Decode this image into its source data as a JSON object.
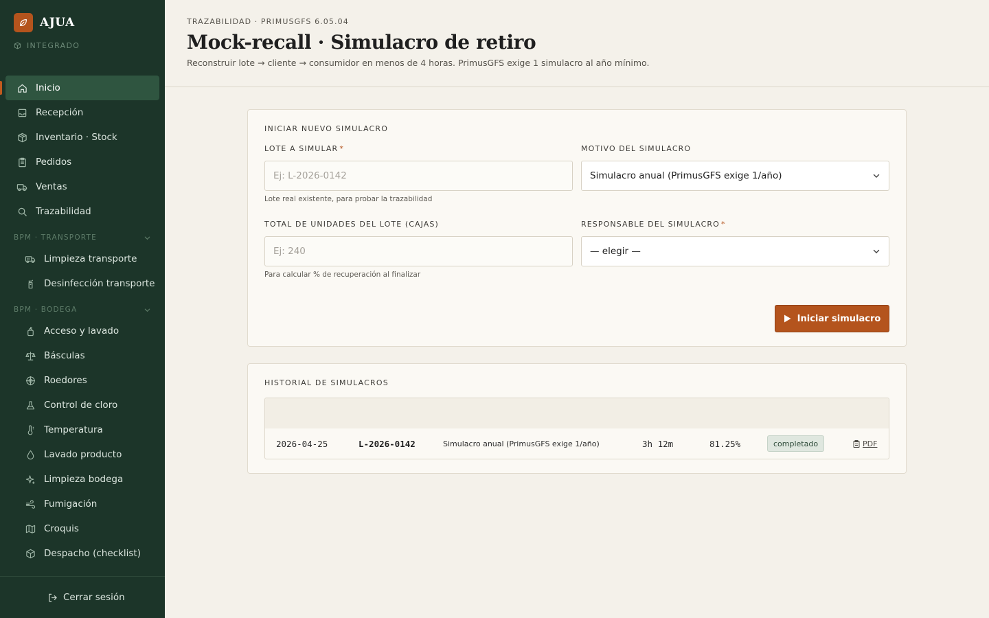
{
  "brand": {
    "name": "AJUA",
    "subtitle": "INTEGRADO"
  },
  "sidebar": {
    "main": [
      {
        "label": "Inicio",
        "icon": "home-icon",
        "active": true
      },
      {
        "label": "Recepción",
        "icon": "inbox-icon"
      },
      {
        "label": "Inventario · Stock",
        "icon": "box-icon"
      },
      {
        "label": "Pedidos",
        "icon": "clipboard-icon"
      },
      {
        "label": "Ventas",
        "icon": "truck-icon"
      },
      {
        "label": "Trazabilidad",
        "icon": "search-icon"
      }
    ],
    "sections": [
      {
        "title": "BPM · TRANSPORTE",
        "items": [
          {
            "label": "Limpieza transporte",
            "icon": "truck-clean-icon"
          },
          {
            "label": "Desinfección transporte",
            "icon": "spray-bottle-icon"
          }
        ]
      },
      {
        "title": "BPM · BODEGA",
        "items": [
          {
            "label": "Acceso y lavado",
            "icon": "soap-icon"
          },
          {
            "label": "Básculas",
            "icon": "scale-icon"
          },
          {
            "label": "Roedores",
            "icon": "target-icon"
          },
          {
            "label": "Control de cloro",
            "icon": "flask-icon"
          },
          {
            "label": "Temperatura",
            "icon": "thermometer-icon"
          },
          {
            "label": "Lavado producto",
            "icon": "droplet-icon"
          },
          {
            "label": "Limpieza bodega",
            "icon": "sparkle-icon"
          },
          {
            "label": "Fumigación",
            "icon": "wind-icon"
          },
          {
            "label": "Croquis",
            "icon": "map-icon"
          },
          {
            "label": "Despacho (checklist)",
            "icon": "package-icon"
          }
        ]
      }
    ],
    "logout": "Cerrar sesión"
  },
  "header": {
    "eyebrow": "TRAZABILIDAD · PRIMUSGFS 6.05.04",
    "title": "Mock-recall · Simulacro de retiro",
    "subtitle": "Reconstruir lote → cliente → consumidor en menos de 4 horas. PrimusGFS exige 1 simulacro al año mínimo."
  },
  "new_sim": {
    "title": "INICIAR NUEVO SIMULACRO",
    "lote_label": "LOTE A SIMULAR",
    "lote_placeholder": "Ej: L-2026-0142",
    "lote_hint": "Lote real existente, para probar la trazabilidad",
    "motivo_label": "MOTIVO DEL SIMULACRO",
    "motivo_value": "Simulacro anual (PrimusGFS exige 1/año)",
    "total_label": "TOTAL DE UNIDADES DEL LOTE (CAJAS)",
    "total_placeholder": "Ej: 240",
    "total_hint": "Para calcular % de recuperación al finalizar",
    "responsable_label": "RESPONSABLE DEL SIMULACRO",
    "responsable_value": "— elegir —",
    "required_mark": "*",
    "submit": "Iniciar simulacro"
  },
  "history": {
    "title": "HISTORIAL DE SIMULACROS",
    "rows": [
      {
        "date": "2026-04-25",
        "lote": "L-2026-0142",
        "motivo": "Simulacro anual (PrimusGFS exige 1/año)",
        "duration": "3h 12m",
        "recovery": "81.25%",
        "status": "completado",
        "pdf": "PDF"
      }
    ]
  },
  "colors": {
    "sidebar_bg": "#1c3529",
    "active_bg": "#2f5540",
    "accent": "#b4541d",
    "page_bg": "#f4f1ea",
    "card_bg": "#fbf9f4",
    "badge_bg": "#dfe7df"
  }
}
